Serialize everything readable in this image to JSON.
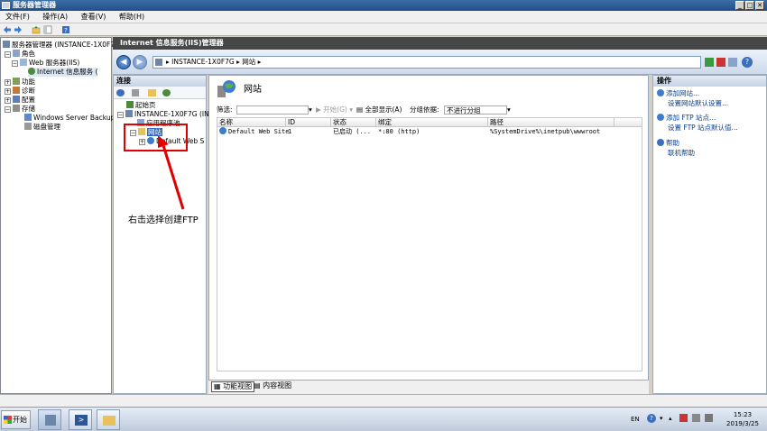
{
  "window": {
    "title": "服务器管理器",
    "controls": [
      "_",
      "□",
      "✕"
    ]
  },
  "menubar": {
    "items": [
      "文件(F)",
      "操作(A)",
      "查看(V)",
      "帮助(H)"
    ]
  },
  "lefttree": {
    "items": [
      {
        "label": "服务器管理器 (INSTANCE-1X0F7",
        "level": 0
      },
      {
        "label": "角色",
        "level": 1
      },
      {
        "label": "Web 服务器(IIS)",
        "level": 2
      },
      {
        "label": "Internet 信息服务 (",
        "level": 3
      },
      {
        "label": "功能",
        "level": 1
      },
      {
        "label": "诊断",
        "level": 1
      },
      {
        "label": "配置",
        "level": 1
      },
      {
        "label": "存储",
        "level": 1
      },
      {
        "label": "Windows Server Backup",
        "level": 2
      },
      {
        "label": "磁盘管理",
        "level": 2
      }
    ]
  },
  "main": {
    "header": "Internet 信息服务(IIS)管理器",
    "address": {
      "segments": [
        "INSTANCE-1X0F7G",
        "网站"
      ]
    }
  },
  "connections": {
    "title": "连接",
    "items": [
      {
        "label": "起始页",
        "level": 0
      },
      {
        "label": "INSTANCE-1X0F7G (INS",
        "level": 0
      },
      {
        "label": "应用程序池",
        "level": 1
      },
      {
        "label": "网站",
        "level": 1
      },
      {
        "label": "Default Web S",
        "level": 2
      }
    ]
  },
  "center": {
    "title": "网站",
    "filter": {
      "label": "筛选:",
      "start_label": "开始(G)",
      "show_all_label": "全部显示(A)",
      "group_label": "分组依据:",
      "group_value": "不进行分组"
    },
    "columns": [
      "名称",
      "ID",
      "状态",
      "绑定",
      "路径"
    ],
    "rows": [
      {
        "name": "Default Web Site",
        "id": "1",
        "status": "已启动 (...",
        "binding": "*:80 (http)",
        "path": "%SystemDrive%\\inetpub\\wwwroot"
      }
    ],
    "tabs": [
      "功能视图",
      "内容视图"
    ]
  },
  "actions": {
    "title": "操作",
    "items": [
      "添加网站...",
      "设置网站默认设置...",
      "添加 FTP 站点...",
      "设置 FTP 站点默认值...",
      "帮助",
      "联机帮助"
    ]
  },
  "annotation": {
    "text": "右击选择创建FTP"
  },
  "taskbar": {
    "start_label": "开始",
    "lang": "EN",
    "time": "15:23",
    "date": "2019/3/25"
  },
  "colors": {
    "annotation_red": "#e00000",
    "header_dark": "#474747",
    "link_blue": "#0a3d91"
  }
}
